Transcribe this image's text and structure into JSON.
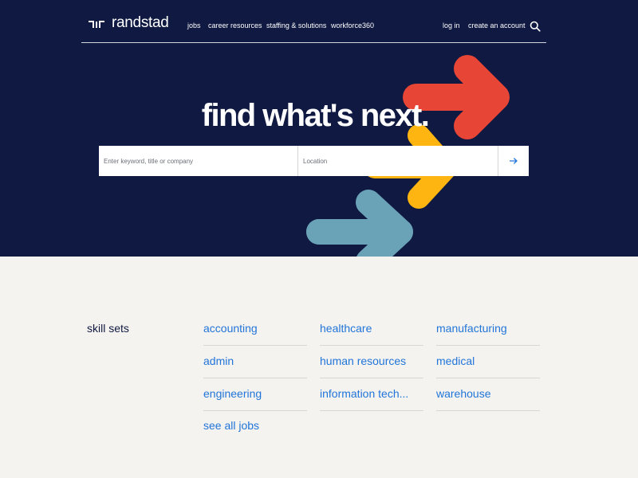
{
  "brand": {
    "name": "randstad"
  },
  "nav": {
    "items": [
      "jobs",
      "career resources",
      "staffing & solutions",
      "workforce360"
    ],
    "login": "log in",
    "create_account": "create an account"
  },
  "hero": {
    "headline": "find what's next.",
    "keyword_placeholder": "Enter keyword, title or company",
    "location_placeholder": "Location",
    "colors": {
      "background": "#0f1941",
      "arrow_red": "#e74536",
      "arrow_yellow": "#ffb511",
      "arrow_blue": "#6aa2b8"
    }
  },
  "skills": {
    "heading": "skill sets",
    "columns": [
      [
        "accounting",
        "admin",
        "engineering",
        "see all jobs"
      ],
      [
        "healthcare",
        "human resources",
        "information tech..."
      ],
      [
        "manufacturing",
        "medical",
        "warehouse"
      ]
    ]
  },
  "colors": {
    "link": "#2175d9",
    "page_bg": "#f5f3ef"
  }
}
